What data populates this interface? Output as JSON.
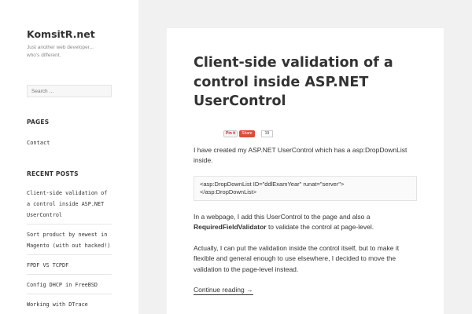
{
  "site": {
    "title": "KomsitR.net",
    "description": "Just another web developer... who's different."
  },
  "search": {
    "placeholder": "Search …"
  },
  "pages_widget": {
    "title": "PAGES",
    "items": [
      "Contact"
    ]
  },
  "recent_posts": {
    "title": "RECENT POSTS",
    "items": [
      "Client-side validation of a control inside ASP.NET UserControl",
      "Sort product by newest in Magento (with out hacked!)",
      "FPDF VS TCPDF",
      "Config DHCP in FreeBSD",
      "Working with DTrace"
    ]
  },
  "post": {
    "title": "Client-side validation of a control inside ASP.NET UserControl",
    "share": {
      "pinit": "Pin it",
      "gshare": "Share",
      "count": "19"
    },
    "p1": "I have created my ASP.NET UserControl which has a asp:DropDownList inside.",
    "code": {
      "line1": "<asp:DropDownList ID=\"ddlExamYear\" runat=\"server\">",
      "line2": "</asp:DropDownList>"
    },
    "p2_before": "In a webpage, I add this UserControl to the page and also a ",
    "p2_bold": "RequiredFieldValidator",
    "p2_after": " to validate the control at page-level.",
    "p3": "Actually, I can put the validation inside the control itself, but to make it flexible and general enough to use elsewhere, I decided to move the validation to the page-level instead.",
    "continue": "Continue reading →"
  }
}
